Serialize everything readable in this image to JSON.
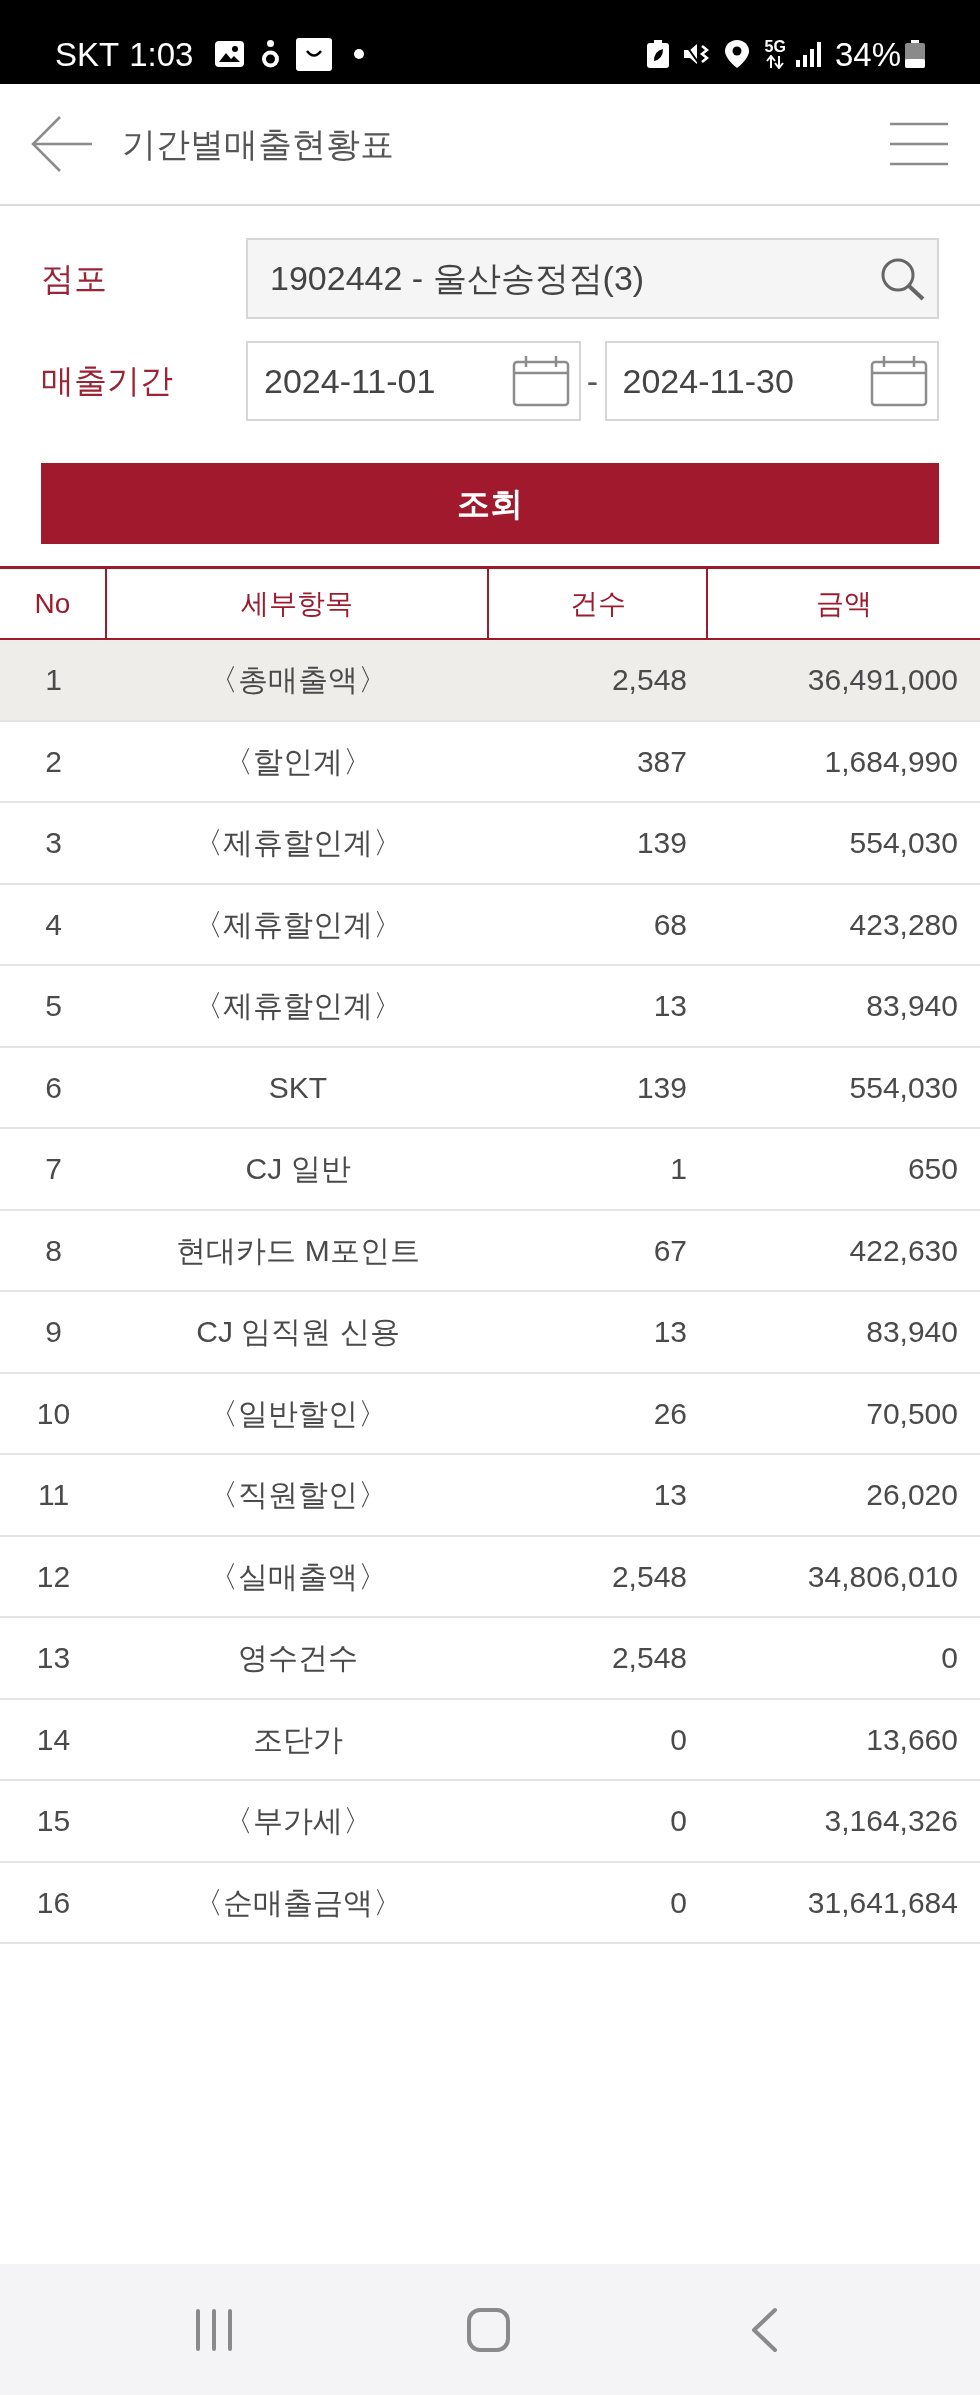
{
  "status_bar": {
    "carrier": "SKT",
    "time": "1:03",
    "network": "5G",
    "battery": "34%"
  },
  "header": {
    "title": "기간별매출현황표"
  },
  "form": {
    "store": {
      "label": "점포",
      "value": "1902442 - 울산송정점(3)"
    },
    "period": {
      "label": "매출기간",
      "start": "2024-11-01",
      "separator": "-",
      "end": "2024-11-30"
    },
    "submit": "조회"
  },
  "table": {
    "columns": [
      "No",
      "세부항목",
      "건수",
      "금액"
    ],
    "rows": [
      {
        "no": "1",
        "item": "〈총매출액〉",
        "count": "2,548",
        "amount": "36,491,000",
        "selected": true
      },
      {
        "no": "2",
        "item": "〈할인계〉",
        "count": "387",
        "amount": "1,684,990",
        "selected": false
      },
      {
        "no": "3",
        "item": "〈제휴할인계〉",
        "count": "139",
        "amount": "554,030",
        "selected": false
      },
      {
        "no": "4",
        "item": "〈제휴할인계〉",
        "count": "68",
        "amount": "423,280",
        "selected": false
      },
      {
        "no": "5",
        "item": "〈제휴할인계〉",
        "count": "13",
        "amount": "83,940",
        "selected": false
      },
      {
        "no": "6",
        "item": "SKT",
        "count": "139",
        "amount": "554,030",
        "selected": false
      },
      {
        "no": "7",
        "item": "CJ 일반",
        "count": "1",
        "amount": "650",
        "selected": false
      },
      {
        "no": "8",
        "item": "현대카드 M포인트",
        "count": "67",
        "amount": "422,630",
        "selected": false
      },
      {
        "no": "9",
        "item": "CJ 임직원 신용",
        "count": "13",
        "amount": "83,940",
        "selected": false
      },
      {
        "no": "10",
        "item": "〈일반할인〉",
        "count": "26",
        "amount": "70,500",
        "selected": false
      },
      {
        "no": "11",
        "item": "〈직원할인〉",
        "count": "13",
        "amount": "26,020",
        "selected": false
      },
      {
        "no": "12",
        "item": "〈실매출액〉",
        "count": "2,548",
        "amount": "34,806,010",
        "selected": false
      },
      {
        "no": "13",
        "item": "영수건수",
        "count": "2,548",
        "amount": "0",
        "selected": false
      },
      {
        "no": "14",
        "item": "조단가",
        "count": "0",
        "amount": "13,660",
        "selected": false
      },
      {
        "no": "15",
        "item": "〈부가세〉",
        "count": "0",
        "amount": "3,164,326",
        "selected": false
      },
      {
        "no": "16",
        "item": "〈순매출금액〉",
        "count": "0",
        "amount": "31,641,684",
        "selected": false
      }
    ]
  }
}
